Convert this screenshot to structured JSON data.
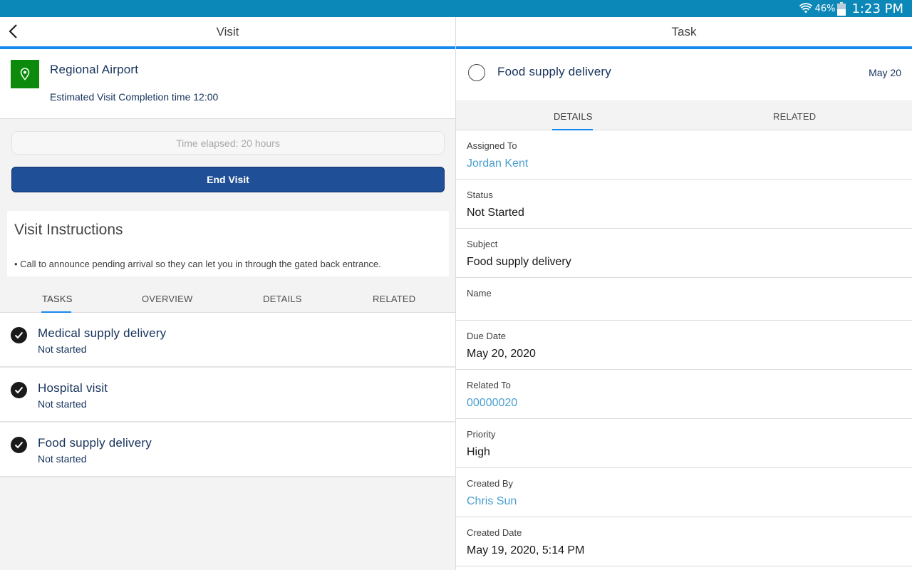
{
  "status_bar": {
    "battery_pct": "46%",
    "time": "1:23 PM"
  },
  "left": {
    "header_title": "Visit",
    "location": {
      "name": "Regional Airport",
      "subtitle": "Estimated Visit Completion time 12:00"
    },
    "elapsed": "Time elapsed: 20 hours",
    "end_visit_label": "End Visit",
    "instructions": {
      "title": "Visit Instructions",
      "text": "• Call to announce pending arrival so they can let you in through the gated back entrance."
    },
    "tabs": [
      {
        "label": "TASKS",
        "active": true
      },
      {
        "label": "OVERVIEW",
        "active": false
      },
      {
        "label": "DETAILS",
        "active": false
      },
      {
        "label": "RELATED",
        "active": false
      }
    ],
    "tasks": [
      {
        "name": "Medical supply delivery",
        "status": "Not started"
      },
      {
        "name": "Hospital visit",
        "status": "Not started"
      },
      {
        "name": "Food supply delivery",
        "status": "Not started"
      }
    ]
  },
  "right": {
    "header_title": "Task",
    "task": {
      "title": "Food supply delivery",
      "date": "May 20"
    },
    "tabs": [
      {
        "label": "DETAILS",
        "active": true
      },
      {
        "label": "RELATED",
        "active": false
      }
    ],
    "fields": [
      {
        "label": "Assigned To",
        "value": "Jordan Kent",
        "link": true
      },
      {
        "label": "Status",
        "value": "Not Started",
        "link": false
      },
      {
        "label": "Subject",
        "value": "Food supply delivery",
        "link": false
      },
      {
        "label": "Name",
        "value": "",
        "link": false
      },
      {
        "label": "Due Date",
        "value": "May 20, 2020",
        "link": false
      },
      {
        "label": "Related To",
        "value": "00000020",
        "link": true
      },
      {
        "label": "Priority",
        "value": "High",
        "link": false
      },
      {
        "label": "Created By",
        "value": "Chris Sun",
        "link": true
      },
      {
        "label": "Created Date",
        "value": "May 19, 2020, 5:14 PM",
        "link": false
      }
    ]
  },
  "colors": {
    "status_bar": "#0b87b8",
    "accent": "#1589ee",
    "location_icon_bg": "#0c8a0c",
    "end_visit_bg": "#1f4f96",
    "link": "#4a9fd0"
  }
}
